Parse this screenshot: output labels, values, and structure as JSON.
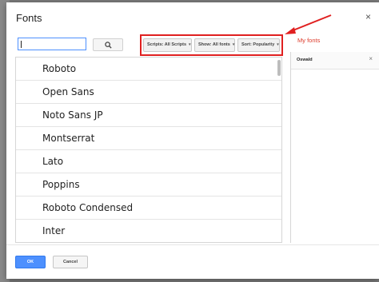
{
  "dialog": {
    "title": "Fonts",
    "close_glyph": "×"
  },
  "search": {
    "value": "",
    "button_icon": "search-icon"
  },
  "filters": {
    "scripts_label": "Scripts: All Scripts",
    "show_label": "Show: All fonts",
    "sort_label": "Sort: Popularity",
    "dropdown_glyph": "▾"
  },
  "font_list": {
    "items": [
      {
        "label": "Roboto"
      },
      {
        "label": "Open Sans"
      },
      {
        "label": "Noto Sans JP"
      },
      {
        "label": "Montserrat"
      },
      {
        "label": "Lato"
      },
      {
        "label": "Poppins"
      },
      {
        "label": "Roboto Condensed"
      },
      {
        "label": "Inter"
      }
    ]
  },
  "my_fonts": {
    "heading": "My fonts",
    "items": [
      {
        "label": "Oswald",
        "remove_glyph": "×"
      }
    ]
  },
  "footer": {
    "ok_label": "OK",
    "cancel_label": "Cancel"
  },
  "colors": {
    "accent_blue": "#4d90fe",
    "highlight_red": "#e02020",
    "my_fonts_red": "#dd3b2b"
  }
}
